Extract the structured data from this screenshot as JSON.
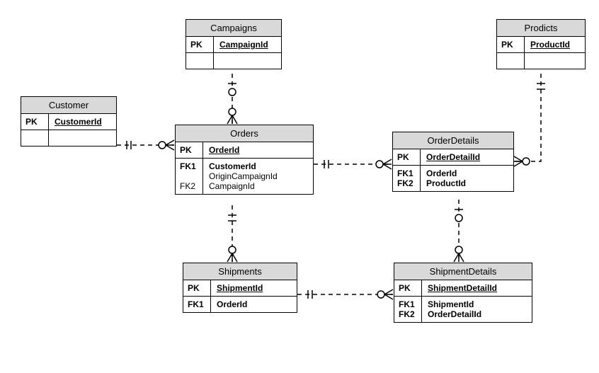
{
  "diagram": {
    "type": "entity-relationship",
    "entities": {
      "customer": {
        "title": "Customer",
        "pk_label": "PK",
        "pk_field": "CustomerId",
        "fks": []
      },
      "campaigns": {
        "title": "Campaigns",
        "pk_label": "PK",
        "pk_field": "CampaignId",
        "fks": []
      },
      "products": {
        "title": "Prodicts",
        "pk_label": "PK",
        "pk_field": "ProductId",
        "fks": []
      },
      "orders": {
        "title": "Orders",
        "pk_label": "PK",
        "pk_field": "OrderId",
        "fk1_label": "FK1",
        "fk1_field": "CustomerId",
        "fk2a_field": "OriginCampaignId",
        "fk2_label": "FK2",
        "fk2_field": "CampaignId"
      },
      "orderdetails": {
        "title": "OrderDetails",
        "pk_label": "PK",
        "pk_field": "OrderDetailId",
        "fk1_label": "FK1",
        "fk1_field": "OrderId",
        "fk2_label": "FK2",
        "fk2_field": "ProductId"
      },
      "shipments": {
        "title": "Shipments",
        "pk_label": "PK",
        "pk_field": "ShipmentId",
        "fk1_label": "FK1",
        "fk1_field": "OrderId"
      },
      "shipmentdetails": {
        "title": "ShipmentDetails",
        "pk_label": "PK",
        "pk_field": "ShipmentDetailId",
        "fk1_label": "FK1",
        "fk1_field": "ShipmentId",
        "fk2_label": "FK2",
        "fk2_field": "OrderDetailId"
      }
    },
    "relationships": [
      {
        "from": "customer",
        "to": "orders",
        "from_card": "zero-or-one",
        "to_card": "zero-or-many"
      },
      {
        "from": "campaigns",
        "to": "orders",
        "from_card": "zero-or-one",
        "to_card": "zero-or-many"
      },
      {
        "from": "orders",
        "to": "orderdetails",
        "from_card": "zero-or-one",
        "to_card": "zero-or-many"
      },
      {
        "from": "products",
        "to": "orderdetails",
        "from_card": "zero-or-one",
        "to_card": "zero-or-many"
      },
      {
        "from": "orders",
        "to": "shipments",
        "from_card": "zero-or-one",
        "to_card": "zero-or-many"
      },
      {
        "from": "orderdetails",
        "to": "shipmentdetails",
        "from_card": "zero-or-one",
        "to_card": "zero-or-many"
      },
      {
        "from": "shipments",
        "to": "shipmentdetails",
        "from_card": "zero-or-one",
        "to_card": "zero-or-many"
      }
    ]
  }
}
